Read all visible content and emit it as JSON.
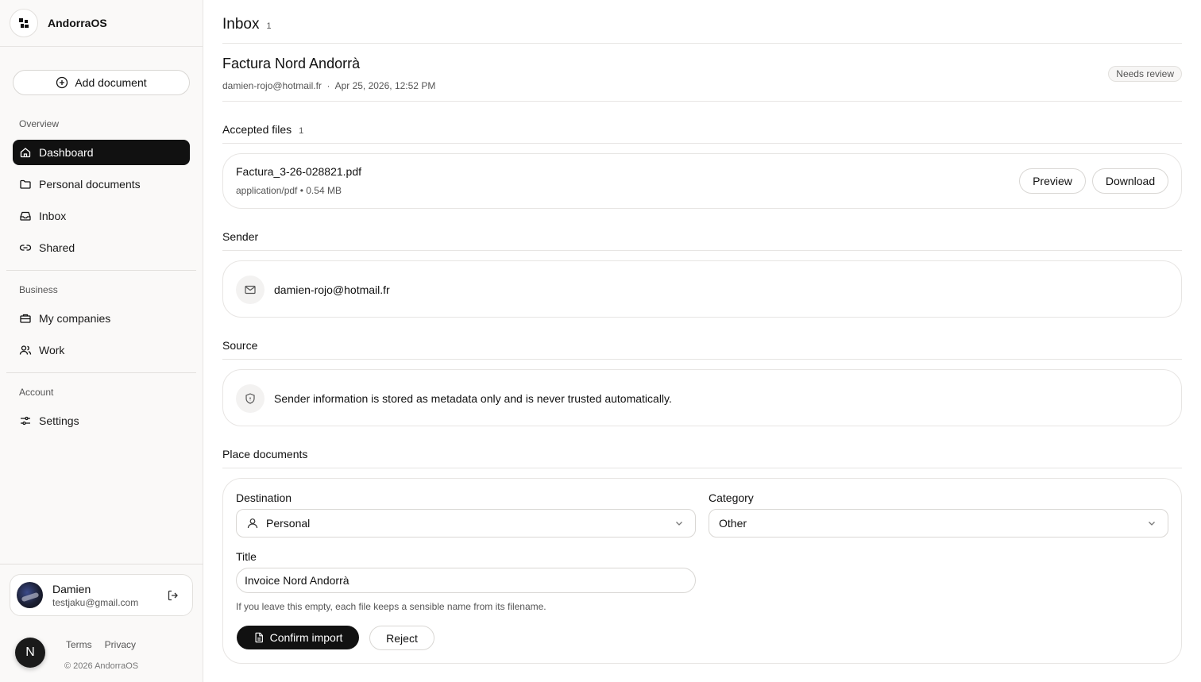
{
  "app": {
    "name": "AndorraOS"
  },
  "sidebar": {
    "add_document_label": "Add document",
    "sections": {
      "overview": "Overview",
      "business": "Business",
      "account": "Account"
    },
    "items": [
      {
        "label": "Dashboard",
        "icon": "home-icon",
        "active": true
      },
      {
        "label": "Personal documents",
        "icon": "folder-icon"
      },
      {
        "label": "Inbox",
        "icon": "inbox-icon"
      },
      {
        "label": "Shared",
        "icon": "link-icon"
      },
      {
        "label": "My companies",
        "icon": "briefcase-icon"
      },
      {
        "label": "Work",
        "icon": "users-icon"
      },
      {
        "label": "Settings",
        "icon": "sliders-icon"
      }
    ],
    "user": {
      "name": "Damien",
      "email": "testjaku@gmail.com"
    },
    "footer": {
      "terms": "Terms",
      "privacy": "Privacy",
      "copyright": "© 2026 AndorraOS"
    },
    "n_badge": "N"
  },
  "main": {
    "header": {
      "title": "Inbox",
      "count": "1"
    },
    "document": {
      "title": "Factura Nord Andorrà",
      "meta": "damien-rojo@hotmail.fr  ·  Apr 25, 2026, 12:52 PM",
      "status": "Needs review"
    },
    "accepted_files": {
      "label": "Accepted files",
      "count": "1",
      "file": {
        "name": "Factura_3-26-028821.pdf",
        "meta": "application/pdf • 0.54 MB",
        "preview_label": "Preview",
        "download_label": "Download"
      }
    },
    "sender": {
      "label": "Sender",
      "email": "damien-rojo@hotmail.fr"
    },
    "source": {
      "label": "Source",
      "text": "Sender information is stored as metadata only and is never trusted automatically."
    },
    "place": {
      "label": "Place documents",
      "destination_label": "Destination",
      "destination_value": "Personal",
      "category_label": "Category",
      "category_value": "Other",
      "title_label": "Title",
      "title_value": "Invoice Nord Andorrà",
      "hint": "If you leave this empty, each file keeps a sensible name from its filename.",
      "confirm_label": "Confirm import",
      "reject_label": "Reject"
    }
  },
  "colors": {
    "accent": "#111111",
    "background": "#ffffff",
    "sidebar_bg": "#faf9f8",
    "border": "#e7e5e3"
  }
}
